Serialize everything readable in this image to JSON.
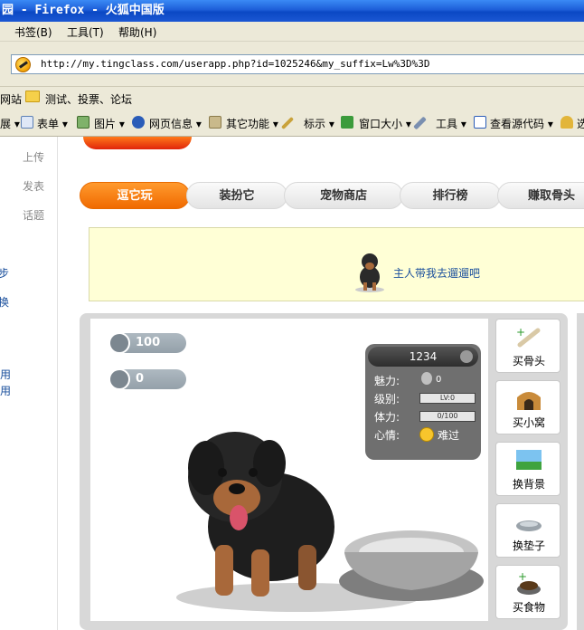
{
  "window": {
    "title": "园 - Firefox - 火狐中国版"
  },
  "menubar": {
    "items": [
      "书签(B)",
      "工具(T)",
      "帮助(H)"
    ]
  },
  "address": {
    "url": "http://my.tingclass.com/userapp.php?id=1025246&my_suffix=Lw%3D%3D"
  },
  "bookmarks": {
    "items": [
      "网站",
      "测试、投票、论坛"
    ]
  },
  "extensions": {
    "items": [
      "展",
      "表单",
      "图片",
      "网页信息",
      "其它功能",
      "标示",
      "窗口大小",
      "工具",
      "查看源代码",
      "选"
    ]
  },
  "sidebar": {
    "gray_items": [
      "上传",
      "发表",
      "话题"
    ],
    "blue_items": [
      "步",
      "换",
      "用",
      "用"
    ]
  },
  "tabs": [
    "逗它玩",
    "装扮它",
    "宠物商店",
    "排行榜",
    "赚取骨头"
  ],
  "notice": {
    "text": "主人带我去遛遛吧"
  },
  "game": {
    "bones": "100",
    "food": "0",
    "pet_name": "1234",
    "stats": {
      "charm_label": "魅力:",
      "charm_value": "0",
      "level_label": "级别:",
      "level_value": "LV:0",
      "stamina_label": "体力:",
      "stamina_value": "0/100",
      "mood_label": "心情:",
      "mood_value": "难过"
    },
    "buttons": [
      "买骨头",
      "买小窝",
      "换背景",
      "换垫子",
      "买食物"
    ]
  },
  "colors": {
    "tab_active": "#f27a0a",
    "notice_bg": "#ffffd6",
    "link": "#1a4f9c"
  }
}
